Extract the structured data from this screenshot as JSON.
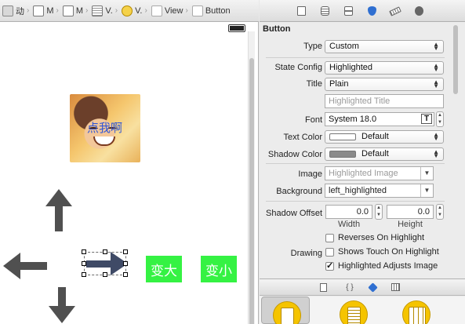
{
  "jumpbar": {
    "crumbs": [
      {
        "label": "动",
        "icon": "folder-icon"
      },
      {
        "label": "M",
        "icon": "file-icon"
      },
      {
        "label": "M",
        "icon": "file-icon"
      },
      {
        "label": "V.",
        "icon": "storyboard-icon"
      },
      {
        "label": "V.",
        "icon": "scene-icon"
      },
      {
        "label": "View",
        "icon": "view-icon"
      },
      {
        "label": "Button",
        "icon": "button-icon"
      }
    ]
  },
  "canvas": {
    "image_button_label": "点我啊",
    "enlarge_label": "变大",
    "shrink_label": "变小",
    "arrows": [
      "arrow-up",
      "arrow-down",
      "arrow-left",
      "arrow-right"
    ],
    "green": "#35f243",
    "arrow_color": "#505050",
    "selected_arrow_color": "#3f4a66"
  },
  "inspector": {
    "tabs": [
      "file-icon",
      "quick-help-icon",
      "identity-icon",
      "attributes-icon",
      "size-icon",
      "connections-icon"
    ],
    "active_tab": "attributes-icon",
    "section_title": "Button",
    "type": {
      "label": "Type",
      "value": "Custom"
    },
    "state_config": {
      "label": "State Config",
      "value": "Highlighted"
    },
    "title": {
      "label": "Title",
      "value": "Plain",
      "placeholder": "Highlighted Title"
    },
    "font": {
      "label": "Font",
      "value": "System 18.0",
      "icon_letter": "T"
    },
    "text_color": {
      "label": "Text Color",
      "value": "Default",
      "swatch": "#ffffff"
    },
    "shadow_color": {
      "label": "Shadow Color",
      "value": "Default",
      "swatch": "#8a8a8a"
    },
    "image": {
      "label": "Image",
      "placeholder": "Highlighted Image"
    },
    "background": {
      "label": "Background",
      "value": "left_highlighted"
    },
    "shadow_offset": {
      "label": "Shadow Offset",
      "width_value": "0.0",
      "height_value": "0.0",
      "width_label": "Width",
      "height_label": "Height"
    },
    "drawing_label": "Drawing",
    "checkboxes": {
      "reverses": {
        "label": "Reverses On Highlight",
        "checked": false
      },
      "shows_touch": {
        "label": "Shows Touch On Highlight",
        "checked": false
      },
      "adjusts_image": {
        "label": "Highlighted Adjusts Image",
        "checked": true
      }
    }
  },
  "library": {
    "tabs": [
      "file-template-icon",
      "code-snippet-icon",
      "object-icon",
      "media-icon"
    ],
    "tab_glyphs": [
      "",
      "{ }",
      "",
      ""
    ],
    "active_tab": "object-icon"
  }
}
